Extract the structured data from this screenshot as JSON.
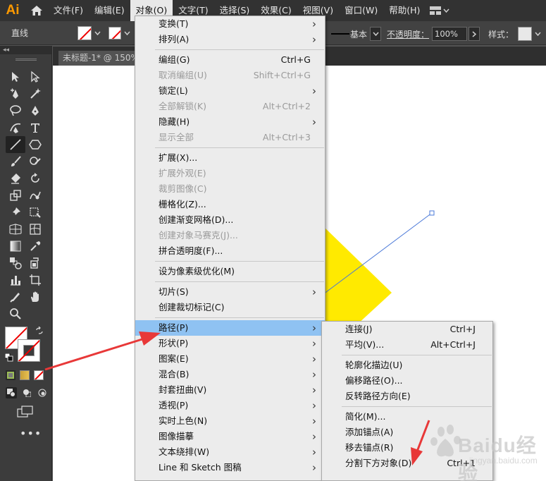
{
  "menubar": {
    "logo": "Ai",
    "items": [
      "文件(F)",
      "编辑(E)",
      "对象(O)",
      "文字(T)",
      "选择(S)",
      "效果(C)",
      "视图(V)",
      "窗口(W)",
      "帮助(H)"
    ]
  },
  "controlbar": {
    "tool_name": "直线",
    "stroke_style": "基本",
    "opacity_label": "不透明度：",
    "opacity_value": "100%",
    "style_label": "样式："
  },
  "toolpanel": {
    "header": "◂◂"
  },
  "document": {
    "tab_label": "未标题-1* @ 150%"
  },
  "object_menu": [
    {
      "label": "变换(T)",
      "shortcut": "",
      "submenu": true,
      "disabled": false
    },
    {
      "label": "排列(A)",
      "shortcut": "",
      "submenu": true,
      "disabled": false
    },
    {
      "sep": true
    },
    {
      "label": "编组(G)",
      "shortcut": "Ctrl+G",
      "submenu": false,
      "disabled": false
    },
    {
      "label": "取消编组(U)",
      "shortcut": "Shift+Ctrl+G",
      "submenu": false,
      "disabled": true
    },
    {
      "label": "锁定(L)",
      "shortcut": "",
      "submenu": true,
      "disabled": false
    },
    {
      "label": "全部解锁(K)",
      "shortcut": "Alt+Ctrl+2",
      "submenu": false,
      "disabled": true
    },
    {
      "label": "隐藏(H)",
      "shortcut": "",
      "submenu": true,
      "disabled": false
    },
    {
      "label": "显示全部",
      "shortcut": "Alt+Ctrl+3",
      "submenu": false,
      "disabled": true
    },
    {
      "sep": true
    },
    {
      "label": "扩展(X)...",
      "shortcut": "",
      "submenu": false,
      "disabled": false
    },
    {
      "label": "扩展外观(E)",
      "shortcut": "",
      "submenu": false,
      "disabled": true
    },
    {
      "label": "裁剪图像(C)",
      "shortcut": "",
      "submenu": false,
      "disabled": true
    },
    {
      "label": "栅格化(Z)...",
      "shortcut": "",
      "submenu": false,
      "disabled": false
    },
    {
      "label": "创建渐变网格(D)...",
      "shortcut": "",
      "submenu": false,
      "disabled": false
    },
    {
      "label": "创建对象马赛克(J)...",
      "shortcut": "",
      "submenu": false,
      "disabled": true
    },
    {
      "label": "拼合透明度(F)...",
      "shortcut": "",
      "submenu": false,
      "disabled": false
    },
    {
      "sep": true
    },
    {
      "label": "设为像素级优化(M)",
      "shortcut": "",
      "submenu": false,
      "disabled": false
    },
    {
      "sep": true
    },
    {
      "label": "切片(S)",
      "shortcut": "",
      "submenu": true,
      "disabled": false
    },
    {
      "label": "创建裁切标记(C)",
      "shortcut": "",
      "submenu": false,
      "disabled": false
    },
    {
      "sep": true
    },
    {
      "label": "路径(P)",
      "shortcut": "",
      "submenu": true,
      "disabled": false,
      "highlighted": true
    },
    {
      "label": "形状(P)",
      "shortcut": "",
      "submenu": true,
      "disabled": false
    },
    {
      "label": "图案(E)",
      "shortcut": "",
      "submenu": true,
      "disabled": false
    },
    {
      "label": "混合(B)",
      "shortcut": "",
      "submenu": true,
      "disabled": false
    },
    {
      "label": "封套扭曲(V)",
      "shortcut": "",
      "submenu": true,
      "disabled": false
    },
    {
      "label": "透视(P)",
      "shortcut": "",
      "submenu": true,
      "disabled": false
    },
    {
      "label": "实时上色(N)",
      "shortcut": "",
      "submenu": true,
      "disabled": false
    },
    {
      "label": "图像描摹",
      "shortcut": "",
      "submenu": true,
      "disabled": false
    },
    {
      "label": "文本绕排(W)",
      "shortcut": "",
      "submenu": true,
      "disabled": false
    },
    {
      "label": "Line 和 Sketch 图稿",
      "shortcut": "",
      "submenu": true,
      "disabled": false
    }
  ],
  "path_menu": [
    {
      "label": "连接(J)",
      "shortcut": "Ctrl+J"
    },
    {
      "label": "平均(V)...",
      "shortcut": "Alt+Ctrl+J"
    },
    {
      "sep": true
    },
    {
      "label": "轮廓化描边(U)",
      "shortcut": ""
    },
    {
      "label": "偏移路径(O)...",
      "shortcut": ""
    },
    {
      "label": "反转路径方向(E)",
      "shortcut": ""
    },
    {
      "sep": true
    },
    {
      "label": "简化(M)...",
      "shortcut": ""
    },
    {
      "label": "添加锚点(A)",
      "shortcut": ""
    },
    {
      "label": "移去锚点(R)",
      "shortcut": ""
    },
    {
      "label": "分割下方对象(D)",
      "shortcut": "Ctrl+1"
    }
  ],
  "watermark": {
    "text": "Baidu经验",
    "sub": "jingyan.baidu.com"
  },
  "colors": {
    "menu_highlight": "#8fc2f2",
    "yellow_shape": "#ffea00",
    "line_stroke": "#4a78d8",
    "annotation_arrow": "#e83838"
  }
}
